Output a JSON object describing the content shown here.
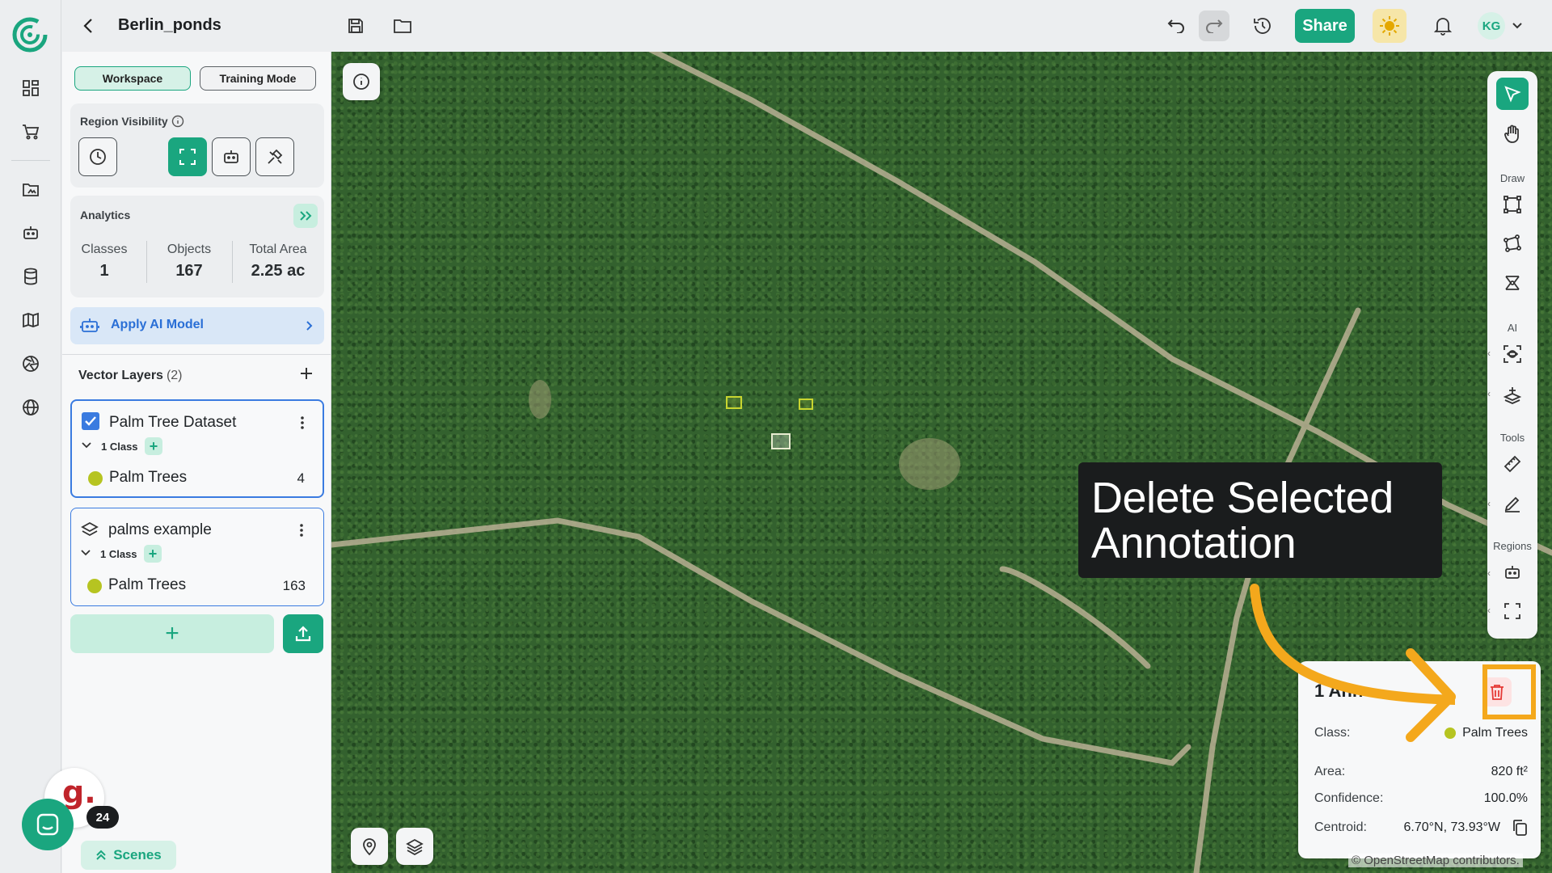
{
  "app": {
    "project_title": "Berlin_ponds"
  },
  "topbar": {
    "share_label": "Share",
    "user_initials": "KG"
  },
  "panel": {
    "modes": [
      "Workspace",
      "Training Mode"
    ],
    "region_visibility_label": "Region Visibility",
    "analytics": {
      "title": "Analytics",
      "stats": [
        {
          "label": "Classes",
          "value": "1"
        },
        {
          "label": "Objects",
          "value": "167"
        },
        {
          "label": "Total Area",
          "value": "2.25 ac"
        }
      ]
    },
    "apply_ai_label": "Apply AI Model",
    "vector_layers": {
      "title": "Vector Layers",
      "count": "(2)",
      "layers": [
        {
          "name": "Palm Tree Dataset",
          "class_count": "1 Class",
          "class_name": "Palm Trees",
          "class_objects": "4",
          "class_color": "#b6c421"
        },
        {
          "name": "palms example",
          "class_count": "1 Class",
          "class_name": "Palm Trees",
          "class_objects": "163",
          "class_color": "#b6c421"
        }
      ]
    },
    "scenes_label": "Scenes",
    "notification_count": "24",
    "g_logo_text": "g."
  },
  "toolbar": {
    "groups": [
      "Draw",
      "AI",
      "Tools",
      "Regions"
    ]
  },
  "tooltip": {
    "line1": "Delete Selected",
    "line2": "Annotation"
  },
  "annotation": {
    "heading": "1 Ann",
    "class_label": "Class:",
    "class_value": "Palm Trees",
    "area_label": "Area:",
    "area_value": "820 ft²",
    "confidence_label": "Confidence:",
    "confidence_value": "100.0%",
    "centroid_label": "Centroid:",
    "centroid_value": "6.70°N, 73.93°W"
  },
  "map": {
    "attribution": "© OpenStreetMap contributors."
  },
  "colors": {
    "accent": "#1aa67f",
    "highlight": "#f4a81c",
    "class": "#b6c421"
  }
}
